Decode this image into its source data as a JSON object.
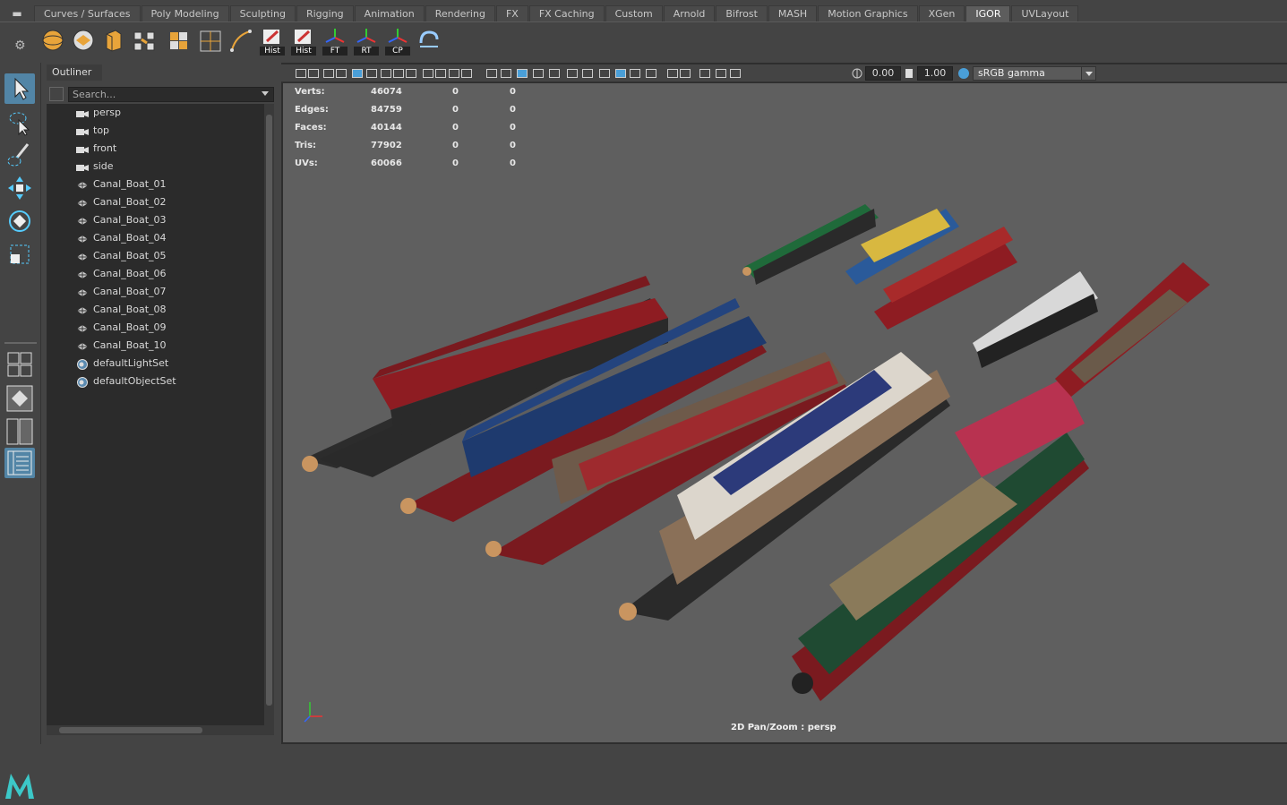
{
  "shelf": {
    "tabs": [
      "Curves / Surfaces",
      "Poly Modeling",
      "Sculpting",
      "Rigging",
      "Animation",
      "Rendering",
      "FX",
      "FX Caching",
      "Custom",
      "Arnold",
      "Bifrost",
      "MASH",
      "Motion Graphics",
      "XGen",
      "IGOR",
      "UVLayout"
    ],
    "active_tab": "IGOR",
    "buttons": [
      "Hist",
      "Hist",
      "FT",
      "RT",
      "CP"
    ]
  },
  "outliner": {
    "title": "Outliner",
    "search_placeholder": "Search...",
    "items": [
      {
        "label": "persp",
        "icon": "camera-icon"
      },
      {
        "label": "top",
        "icon": "camera-icon"
      },
      {
        "label": "front",
        "icon": "camera-icon"
      },
      {
        "label": "side",
        "icon": "camera-icon"
      },
      {
        "label": "Canal_Boat_01",
        "icon": "mesh-icon"
      },
      {
        "label": "Canal_Boat_02",
        "icon": "mesh-icon"
      },
      {
        "label": "Canal_Boat_03",
        "icon": "mesh-icon"
      },
      {
        "label": "Canal_Boat_04",
        "icon": "mesh-icon"
      },
      {
        "label": "Canal_Boat_05",
        "icon": "mesh-icon"
      },
      {
        "label": "Canal_Boat_06",
        "icon": "mesh-icon"
      },
      {
        "label": "Canal_Boat_07",
        "icon": "mesh-icon"
      },
      {
        "label": "Canal_Boat_08",
        "icon": "mesh-icon"
      },
      {
        "label": "Canal_Boat_09",
        "icon": "mesh-icon"
      },
      {
        "label": "Canal_Boat_10",
        "icon": "mesh-icon"
      },
      {
        "label": "defaultLightSet",
        "icon": "set-icon"
      },
      {
        "label": "defaultObjectSet",
        "icon": "set-icon"
      }
    ]
  },
  "viewport": {
    "field1": "0.00",
    "field2": "1.00",
    "colorspace": "sRGB gamma",
    "camera_label": "2D Pan/Zoom : persp",
    "hud": {
      "verts": {
        "label": "Verts:",
        "a": "46074",
        "b": "0",
        "c": "0"
      },
      "edges": {
        "label": "Edges:",
        "a": "84759",
        "b": "0",
        "c": "0"
      },
      "faces": {
        "label": "Faces:",
        "a": "40144",
        "b": "0",
        "c": "0"
      },
      "tris": {
        "label": "Tris:",
        "a": "77902",
        "b": "0",
        "c": "0"
      },
      "uvs": {
        "label": "UVs:",
        "a": "60066",
        "b": "0",
        "c": "0"
      }
    }
  },
  "colors": {
    "accent": "#5285a6",
    "viewport_bg": "#5f5f5f",
    "panel": "#444444"
  }
}
